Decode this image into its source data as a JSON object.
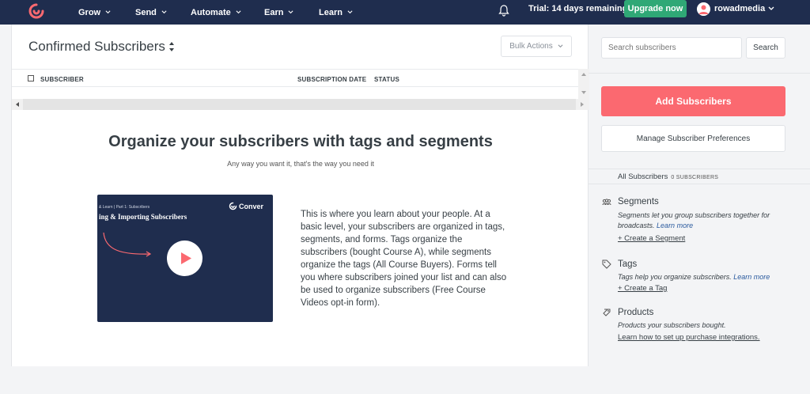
{
  "nav": {
    "items": [
      "Grow",
      "Send",
      "Automate",
      "Earn",
      "Learn"
    ],
    "trial_text": "Trial: 14 days remaining",
    "upgrade_label": "Upgrade now",
    "username": "rowadmedia"
  },
  "main": {
    "title": "Confirmed Subscribers",
    "bulk_actions_label": "Bulk Actions",
    "columns": [
      "SUBSCRIBER",
      "SUBSCRIPTION DATE",
      "STATUS"
    ],
    "empty_title": "Organize your subscribers with tags and segments",
    "empty_subtitle": "Any way you want it, that's the way you need it",
    "video": {
      "crumb": "& Learn | Part 1: Subscribers",
      "title": "ing & Importing Subscribers",
      "brand": "Conver"
    },
    "description": "This is where you learn about your people. At a basic level, your subscribers are organized in tags, segments, and forms. Tags organize the subscribers (bought Course A), while segments organize the tags (All Course Buyers). Forms tell you where subscribers joined your list and can also be used to organize subscribers (Free Course Videos opt-in form)."
  },
  "sidebar": {
    "search_placeholder": "Search subscribers",
    "search_button": "Search",
    "add_button": "Add Subscribers",
    "manage_button": "Manage Subscriber Preferences",
    "all_subscribers_label": "All Subscribers",
    "all_subscribers_count": "0 SUBSCRIBERS",
    "segments": {
      "title": "Segments",
      "desc": "Segments let you group subscribers together for broadcasts.",
      "learn_more": "Learn more",
      "create": "+ Create a Segment"
    },
    "tags": {
      "title": "Tags",
      "desc": "Tags help you organize subscribers.",
      "learn_more": "Learn more",
      "create": "+ Create a Tag"
    },
    "products": {
      "title": "Products",
      "desc": "Products your subscribers bought.",
      "link": "Learn how to set up purchase integrations."
    }
  },
  "colors": {
    "nav_bg": "#1f2d4e",
    "upgrade_green": "#2fa876",
    "add_button_red": "#fb6970",
    "brand_red": "#fb6970"
  }
}
